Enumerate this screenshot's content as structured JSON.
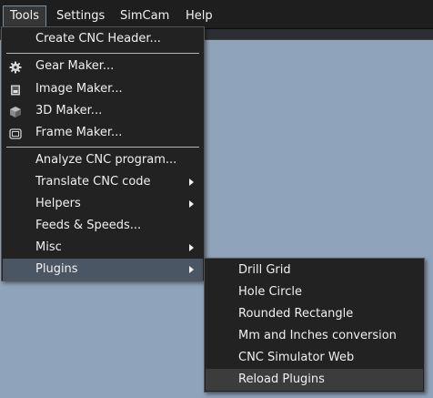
{
  "menubar": {
    "items": [
      "Tools",
      "Settings",
      "SimCam",
      "Help"
    ]
  },
  "tools_menu": {
    "items": [
      {
        "label": "Create CNC Header...",
        "icon": null,
        "submenu": false
      },
      {
        "label": "Gear Maker...",
        "icon": "gear-icon",
        "submenu": false
      },
      {
        "label": "Image Maker...",
        "icon": "image-icon",
        "submenu": false
      },
      {
        "label": "3D Maker...",
        "icon": "cube-icon",
        "submenu": false
      },
      {
        "label": "Frame Maker...",
        "icon": "frame-icon",
        "submenu": false
      },
      {
        "label": "Analyze CNC program...",
        "icon": null,
        "submenu": false
      },
      {
        "label": "Translate CNC code",
        "icon": null,
        "submenu": true
      },
      {
        "label": "Helpers",
        "icon": null,
        "submenu": true
      },
      {
        "label": "Feeds & Speeds...",
        "icon": null,
        "submenu": false
      },
      {
        "label": "Misc",
        "icon": null,
        "submenu": true
      },
      {
        "label": "Plugins",
        "icon": null,
        "submenu": true,
        "selected": true
      }
    ]
  },
  "plugins_menu": {
    "items": [
      {
        "label": "Drill Grid"
      },
      {
        "label": "Hole Circle"
      },
      {
        "label": "Rounded Rectangle"
      },
      {
        "label": "Mm and Inches conversion"
      },
      {
        "label": "CNC Simulator Web"
      },
      {
        "label": "Reload Plugins",
        "highlighted": true
      }
    ]
  },
  "colors": {
    "background": "#8fa3bb",
    "menu_bg": "#222222",
    "selected_bg": "#4a5663"
  }
}
